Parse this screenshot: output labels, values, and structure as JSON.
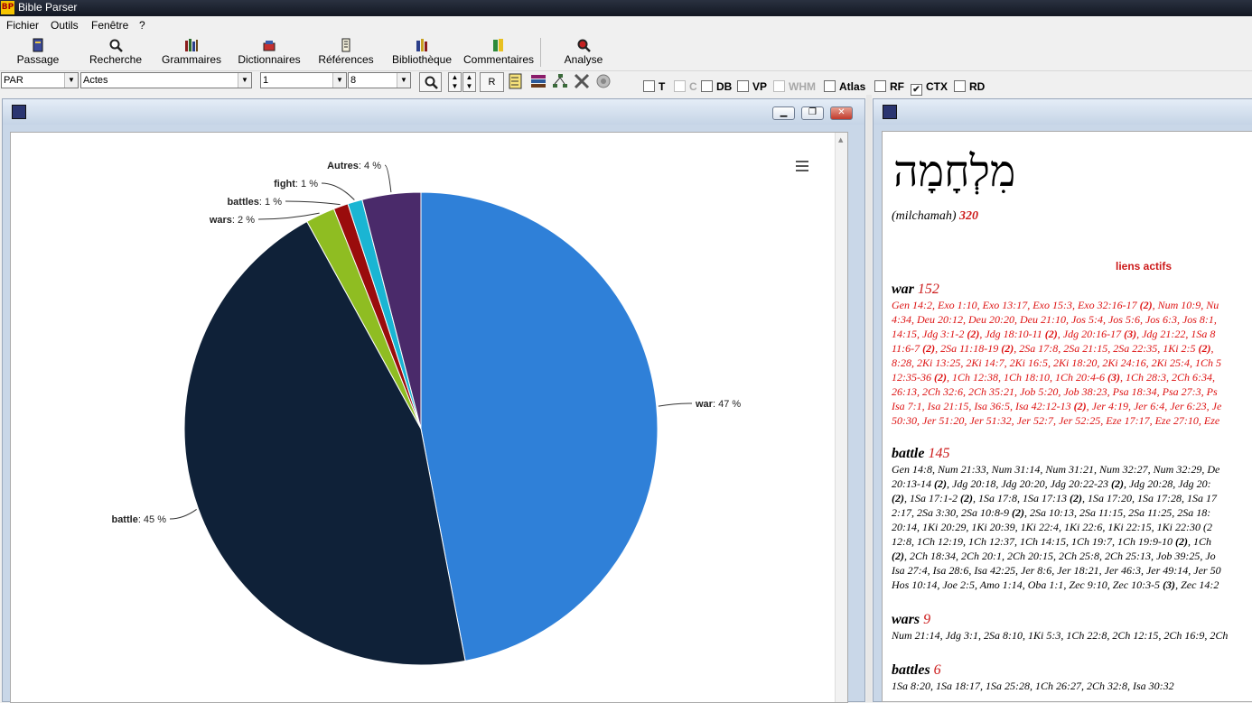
{
  "window": {
    "title": "Bible Parser",
    "app_icon": "BP"
  },
  "menu": [
    {
      "label": "Fichier"
    },
    {
      "label": "Outils"
    },
    {
      "label": "Fenêtre"
    },
    {
      "label": "?"
    }
  ],
  "toolbar": [
    {
      "label": "Passage",
      "icon": "book-icon"
    },
    {
      "label": "Recherche",
      "icon": "magnifier-icon"
    },
    {
      "label": "Grammaires",
      "icon": "books-icon"
    },
    {
      "label": "Dictionnaires",
      "icon": "dictionary-icon"
    },
    {
      "label": "Références",
      "icon": "scroll-icon"
    },
    {
      "label": "Bibliothèque",
      "icon": "library-icon"
    },
    {
      "label": "Commentaires",
      "icon": "commentary-icon"
    },
    {
      "label": "Analyse",
      "icon": "analysis-icon"
    }
  ],
  "nav": {
    "version": "PAR",
    "book": "Actes",
    "chapter": "1",
    "verse": "8",
    "r_button": "R"
  },
  "checkboxes": [
    {
      "label": "T",
      "checked": false,
      "disabled": false
    },
    {
      "label": "C",
      "checked": false,
      "disabled": true
    },
    {
      "label": "DB",
      "checked": false,
      "disabled": false
    },
    {
      "label": "VP",
      "checked": false,
      "disabled": false
    },
    {
      "label": "WHM",
      "checked": false,
      "disabled": true
    },
    {
      "label": "Atlas",
      "checked": false,
      "disabled": false
    },
    {
      "label": "RF",
      "checked": false,
      "disabled": false
    },
    {
      "label": "CTX",
      "checked": true,
      "disabled": false
    },
    {
      "label": "RD",
      "checked": false,
      "disabled": false
    }
  ],
  "chart_data": {
    "type": "pie",
    "title": "",
    "start_angle_deg": 0,
    "direction": "clockwise",
    "slices": [
      {
        "name": "war",
        "value": 47,
        "color": "#2f80d8"
      },
      {
        "name": "battle",
        "value": 45,
        "color": "#0f2138"
      },
      {
        "name": "wars",
        "value": 2,
        "color": "#8fbd22"
      },
      {
        "name": "battles",
        "value": 1,
        "color": "#9a0c0c"
      },
      {
        "name": "fight",
        "value": 1,
        "color": "#1ab5d3"
      },
      {
        "name": "Autres",
        "value": 4,
        "color": "#4a2a6a"
      }
    ],
    "label_suffix": " %",
    "menu_icon": "hamburger-menu-icon"
  },
  "lexicon": {
    "hebrew": "מִלְחָמָה",
    "translit": "(milchamah)",
    "strong": "320",
    "active_links": "liens actifs",
    "sections": [
      {
        "word": "war",
        "count": "152",
        "red": true,
        "lines": [
          "Gen 14:2, Exo 1:10, Exo 13:17, Exo 15:3, Exo 32:16-17 (2), Num 10:9, Nu",
          "4:34, Deu 20:12, Deu 20:20, Deu 21:10, Jos 5:4, Jos 5:6, Jos 6:3, Jos 8:1,",
          "14:15, Jdg 3:1-2 (2), Jdg 18:10-11 (2), Jdg 20:16-17 (3), Jdg 21:22, 1Sa 8",
          "11:6-7 (2), 2Sa 11:18-19 (2), 2Sa 17:8, 2Sa 21:15, 2Sa 22:35, 1Ki 2:5 (2),",
          "8:28, 2Ki 13:25, 2Ki 14:7, 2Ki 16:5, 2Ki 18:20, 2Ki 24:16, 2Ki 25:4, 1Ch 5",
          "12:35-36 (2), 1Ch 12:38, 1Ch 18:10, 1Ch 20:4-6 (3), 1Ch 28:3, 2Ch 6:34,",
          "26:13, 2Ch 32:6, 2Ch 35:21, Job 5:20, Job 38:23, Psa 18:34, Psa 27:3, Ps",
          "Isa 7:1, Isa 21:15, Isa 36:5, Isa 42:12-13 (2), Jer 4:19, Jer 6:4, Jer 6:23, Je",
          "50:30, Jer 51:20, Jer 51:32, Jer 52:7, Jer 52:25, Eze 17:17, Eze 27:10, Eze"
        ]
      },
      {
        "word": "battle",
        "count": "145",
        "red": false,
        "lines": [
          "Gen 14:8, Num 21:33, Num 31:14, Num 31:21, Num 32:27, Num 32:29, De",
          "20:13-14 (2), Jdg 20:18, Jdg 20:20, Jdg 20:22-23 (2), Jdg 20:28, Jdg 20:",
          "(2), 1Sa 17:1-2 (2), 1Sa 17:8, 1Sa 17:13 (2), 1Sa 17:20, 1Sa 17:28, 1Sa 17",
          "2:17, 2Sa 3:30, 2Sa 10:8-9 (2), 2Sa 10:13, 2Sa 11:15, 2Sa 11:25, 2Sa 18:",
          "20:14, 1Ki 20:29, 1Ki 20:39, 1Ki 22:4, 1Ki 22:6, 1Ki 22:15, 1Ki 22:30 (2",
          "12:8, 1Ch 12:19, 1Ch 12:37, 1Ch 14:15, 1Ch 19:7, 1Ch 19:9-10 (2), 1Ch",
          "(2), 2Ch 18:34, 2Ch 20:1, 2Ch 20:15, 2Ch 25:8, 2Ch 25:13, Job 39:25, Jo",
          "Isa 27:4, Isa 28:6, Isa 42:25, Jer 8:6, Jer 18:21, Jer 46:3, Jer 49:14, Jer 50",
          "Hos 10:14, Joe 2:5, Amo 1:14, Oba 1:1, Zec 9:10, Zec 10:3-5 (3), Zec 14:2"
        ]
      },
      {
        "word": "wars",
        "count": "9",
        "red": false,
        "lines": [
          "Num 21:14, Jdg 3:1, 2Sa 8:10, 1Ki 5:3, 1Ch 22:8, 2Ch 12:15, 2Ch 16:9, 2Ch"
        ]
      },
      {
        "word": "battles",
        "count": "6",
        "red": false,
        "lines": [
          "1Sa 8:20, 1Sa 18:17, 1Sa 25:28, 1Ch 26:27, 2Ch 32:8, Isa 30:32"
        ]
      }
    ]
  }
}
